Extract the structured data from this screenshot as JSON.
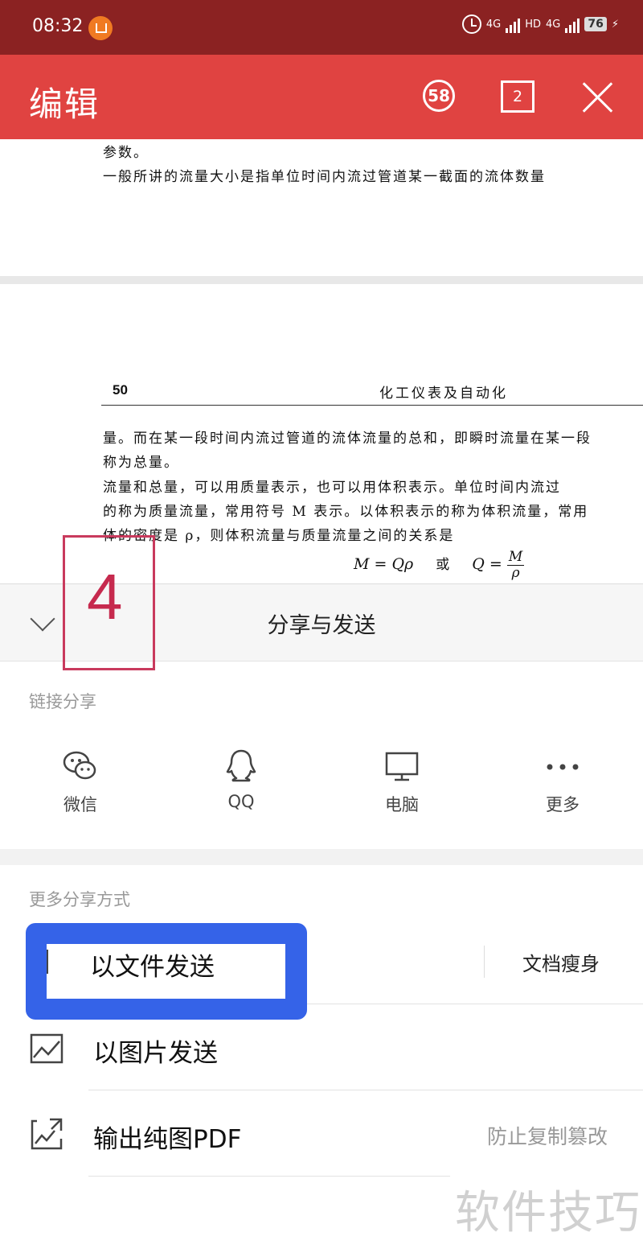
{
  "status_bar": {
    "time": "08:32",
    "network1": "4G",
    "network2": "HD",
    "network3": "4G",
    "battery": "76"
  },
  "title_bar": {
    "title": "编辑",
    "page_count_badge": "58",
    "tabs_badge": "2"
  },
  "document": {
    "page1_lines": [
      "参数。",
      "        一般所讲的流量大小是指单位时间内流过管道某一截面的流体数量"
    ],
    "page_number": "50",
    "page_header": "化工仪表及自动化",
    "page2_lines": [
      "量。而在某一段时间内流过管道的流体流量的总和，即瞬时流量在某一段",
      "称为总量。",
      "        流量和总量，可以用质量表示，也可以用体积表示。单位时间内流过",
      "的称为质量流量，常用符号 M 表示。以体积表示的称为体积流量，常用",
      "体的密度是 ρ，则体积流量与质量流量之间的关系是"
    ],
    "formula_left": "M = Qρ",
    "formula_or": "或",
    "formula_right": "Q =",
    "formula_num": "M",
    "formula_den": "ρ"
  },
  "share_sheet": {
    "title": "分享与发送",
    "link_share_label": "链接分享",
    "link_targets": [
      {
        "label": "微信",
        "icon": "wechat-icon"
      },
      {
        "label": "QQ",
        "icon": "qq-icon"
      },
      {
        "label": "电脑",
        "icon": "computer-icon"
      },
      {
        "label": "更多",
        "icon": "more-icon"
      }
    ],
    "more_share_label": "更多分享方式",
    "send_as_file": "以文件发送",
    "doc_slim": "文档瘦身",
    "send_as_image": "以图片发送",
    "export_pdf": "输出纯图PDF",
    "export_pdf_hint": "防止复制篡改"
  },
  "annotation": {
    "step_number": "4",
    "watermark": "软件技巧"
  },
  "colors": {
    "status_bar": "#8b2222",
    "title_bar": "#e04341",
    "annotation_red": "#c62a4e",
    "annotation_blue": "#3563e8"
  }
}
